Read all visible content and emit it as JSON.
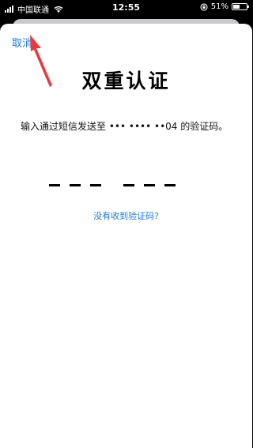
{
  "status_bar": {
    "carrier": "中国联通",
    "time": "12:55",
    "battery_percent": "51%",
    "battery_level": 0.51,
    "icons": [
      "signal-icon",
      "wifi-icon",
      "orientation-lock-icon",
      "battery-icon"
    ]
  },
  "sheet": {
    "cancel_label": "取消",
    "title": "双重认证",
    "message": "输入通过短信发送至 ••• •••• ••04 的验证码。",
    "code_slot_count": 6,
    "resend_link": "没有收到验证码?"
  },
  "colors": {
    "link": "#1f7ae0",
    "annotation_arrow": "#e8383d"
  }
}
